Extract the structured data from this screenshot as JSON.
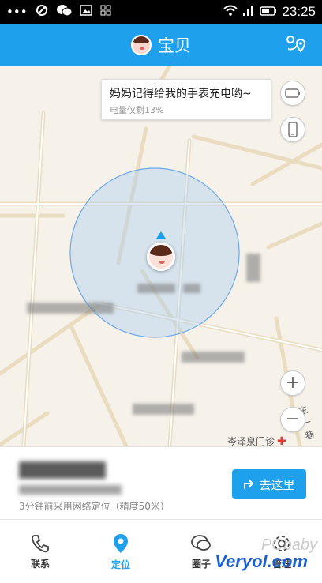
{
  "statusbar": {
    "time": "23:25"
  },
  "appbar": {
    "title": "宝贝"
  },
  "map": {
    "bubble_message": "妈妈记得给我的手表充电哟~",
    "battery_text": "电量仅剩13%",
    "clinic_label": "岑泽泉门诊",
    "road_label": "东一巷"
  },
  "info": {
    "location_time": "3分钟前采用网络定位（精度50米）",
    "go_button_label": "去这里"
  },
  "tabs": [
    {
      "label": "联系",
      "icon": "phone-icon"
    },
    {
      "label": "定位",
      "icon": "location-pin-icon"
    },
    {
      "label": "圈子",
      "icon": "chat-bubbles-icon"
    },
    {
      "label": "管理",
      "icon": "gear-icon"
    }
  ],
  "watermark": {
    "text": "Veryol.com",
    "text2": "PCbaby"
  },
  "colors": {
    "accent": "#1ea0ec"
  }
}
